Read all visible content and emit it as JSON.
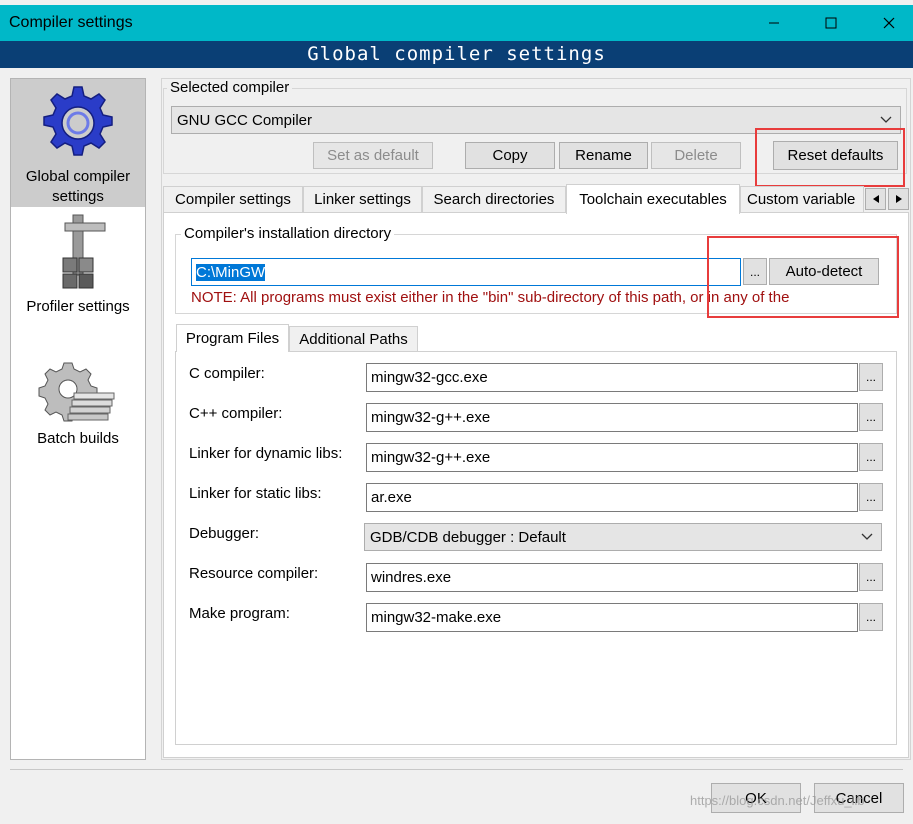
{
  "window": {
    "title": "Compiler settings",
    "header": "Global compiler settings",
    "colors": {
      "titlebar": "#00b8c8",
      "header": "#0a3f75",
      "highlight": "#e83c3c",
      "note": "#a01010"
    }
  },
  "sidebar": {
    "items": [
      {
        "label_line1": "Global compiler",
        "label_line2": "settings",
        "icon": "gear-icon"
      },
      {
        "label": "Profiler settings",
        "icon": "caliper-icon"
      },
      {
        "label": "Batch builds",
        "icon": "gear-stack-icon"
      }
    ]
  },
  "selected_compiler": {
    "group_label": "Selected compiler",
    "value": "GNU GCC Compiler",
    "buttons": {
      "set_default": "Set as default",
      "copy": "Copy",
      "rename": "Rename",
      "delete": "Delete",
      "reset": "Reset defaults"
    }
  },
  "tabs": [
    "Compiler settings",
    "Linker settings",
    "Search directories",
    "Toolchain executables",
    "Custom variable"
  ],
  "install_dir": {
    "group_label": "Compiler's installation directory",
    "value": "C:\\MinGW",
    "browse": "...",
    "autodetect": "Auto-detect",
    "note": "NOTE: All programs must exist either in the \"bin\" sub-directory of this path, or in any of the"
  },
  "subtabs": [
    "Program Files",
    "Additional Paths"
  ],
  "programs": [
    {
      "label": "C compiler:",
      "value": "mingw32-gcc.exe"
    },
    {
      "label": "C++ compiler:",
      "value": "mingw32-g++.exe"
    },
    {
      "label": "Linker for dynamic libs:",
      "value": "mingw32-g++.exe"
    },
    {
      "label": "Linker for static libs:",
      "value": "ar.exe"
    },
    {
      "label": "Debugger:",
      "value": "GDB/CDB debugger : Default"
    },
    {
      "label": "Resource compiler:",
      "value": "windres.exe"
    },
    {
      "label": "Make program:",
      "value": "mingw32-make.exe"
    }
  ],
  "footer": {
    "ok": "OK",
    "cancel": "Cancel",
    "watermark": "https://blog.csdn.net/Jeffxu_lib"
  }
}
